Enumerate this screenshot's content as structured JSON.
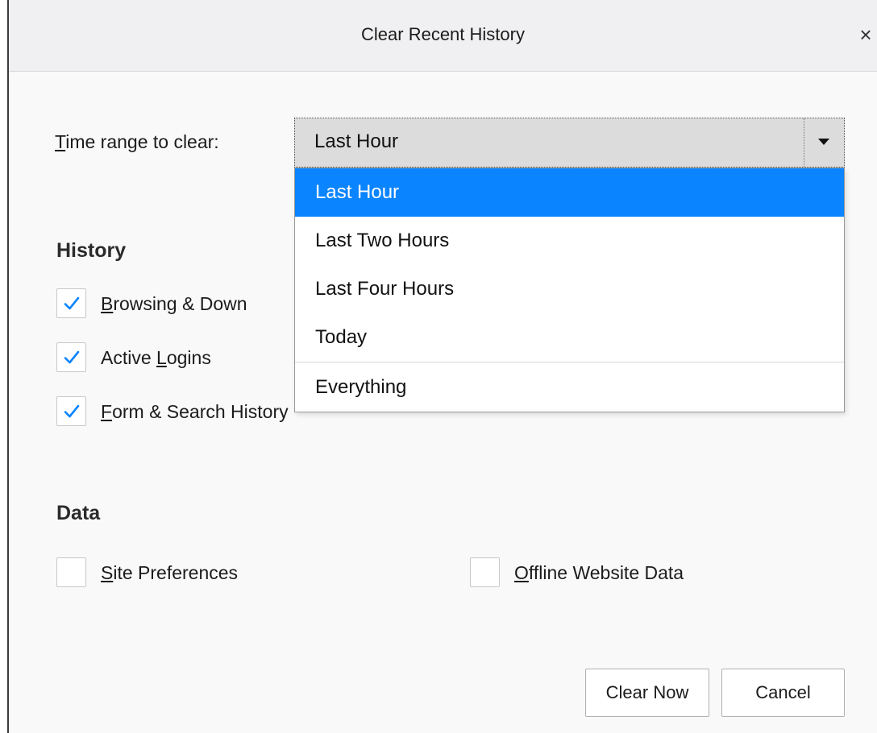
{
  "dialog": {
    "title": "Clear Recent History",
    "close_symbol": "×"
  },
  "time_range": {
    "label_mnemonic": "T",
    "label_rest": "ime range to clear:",
    "selected": "Last Hour",
    "options": [
      "Last Hour",
      "Last Two Hours",
      "Last Four Hours",
      "Today",
      "Everything"
    ]
  },
  "history": {
    "heading": "History",
    "items": [
      {
        "mnemonic": "B",
        "rest": "rowsing & Down",
        "checked": true
      },
      {
        "pre": "Active ",
        "mnemonic": "L",
        "rest": "ogins",
        "checked": true
      },
      {
        "mnemonic": "F",
        "rest": "orm & Search History",
        "checked": true
      }
    ]
  },
  "data": {
    "heading": "Data",
    "items": [
      {
        "mnemonic": "S",
        "rest": "ite Preferences",
        "checked": false
      },
      {
        "mnemonic": "O",
        "rest": "ffline Website Data",
        "checked": false
      }
    ]
  },
  "buttons": {
    "clear_now": "Clear Now",
    "cancel": "Cancel"
  },
  "colors": {
    "accent": "#0a84ff",
    "checkmark": "#0a84ff"
  },
  "icons": {
    "close": "close-icon",
    "dropdown": "chevron-down-icon",
    "check": "checkmark-icon"
  }
}
